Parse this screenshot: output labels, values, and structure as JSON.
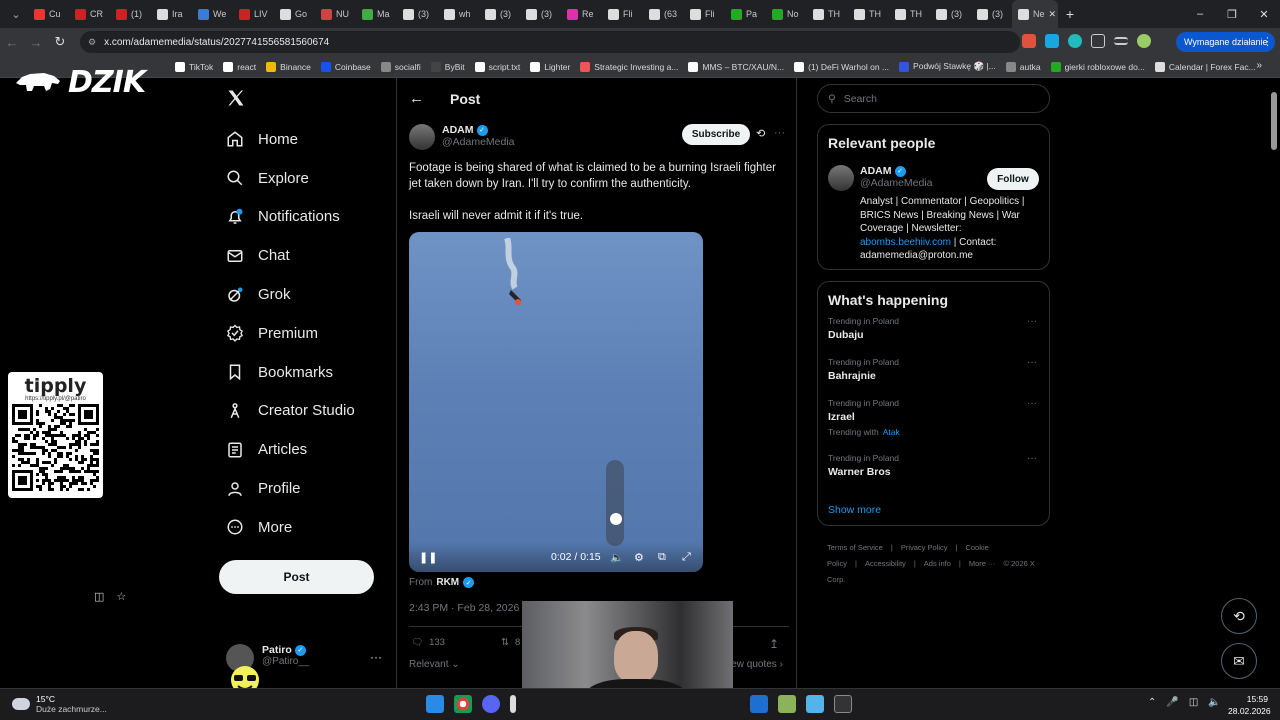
{
  "browser": {
    "tabs": [
      {
        "label": "Cu",
        "color": "#e33"
      },
      {
        "label": "CR",
        "color": "#c22"
      },
      {
        "label": "(1)",
        "color": "#c22"
      },
      {
        "label": "Ira",
        "color": "#ddd"
      },
      {
        "label": "We",
        "color": "#3a7bd5"
      },
      {
        "label": "LIV",
        "color": "#c22"
      },
      {
        "label": "Go",
        "color": "#ddd"
      },
      {
        "label": "NU",
        "color": "#c44"
      },
      {
        "label": "Ma",
        "color": "#4a4"
      },
      {
        "label": "(3)",
        "color": "#ddd"
      },
      {
        "label": "wh",
        "color": "#ddd"
      },
      {
        "label": "(3)",
        "color": "#ddd"
      },
      {
        "label": "(3)",
        "color": "#ddd"
      },
      {
        "label": "Re",
        "color": "#d3a"
      },
      {
        "label": "Fli",
        "color": "#ddd"
      },
      {
        "label": "(63",
        "color": "#ddd"
      },
      {
        "label": "Fli",
        "color": "#ddd"
      },
      {
        "label": "Pa",
        "color": "#2a2"
      },
      {
        "label": "No",
        "color": "#2a2"
      },
      {
        "label": "TH",
        "color": "#ddd"
      },
      {
        "label": "TH",
        "color": "#ddd"
      },
      {
        "label": "TH",
        "color": "#ddd"
      },
      {
        "label": "(3)",
        "color": "#ddd"
      },
      {
        "label": "(3)",
        "color": "#ddd"
      },
      {
        "label": "Ne",
        "color": "#ddd"
      }
    ],
    "url": "x.com/adamemedia/status/2027741556581560674",
    "action_required": "Wymagane działanie",
    "bookmarks": [
      {
        "label": "TikTok",
        "color": "#fff"
      },
      {
        "label": "react",
        "color": "#fff"
      },
      {
        "label": "Binance",
        "color": "#f0b90b"
      },
      {
        "label": "Coinbase",
        "color": "#1652f0"
      },
      {
        "label": "socialfi",
        "color": "#888"
      },
      {
        "label": "ByBit",
        "color": "#444"
      },
      {
        "label": "script.txt",
        "color": "#fff"
      },
      {
        "label": "Lighter",
        "color": "#fff"
      },
      {
        "label": "Strategic Investing a...",
        "color": "#e55"
      },
      {
        "label": "MMS – BTC/XAU/N...",
        "color": "#fff"
      },
      {
        "label": "(1) DeFi Warhol on ...",
        "color": "#fff"
      },
      {
        "label": "Podwój Stawkę 🎲 |...",
        "color": "#3355dd"
      },
      {
        "label": "autka",
        "color": "#888"
      },
      {
        "label": "gierki robloxowe do...",
        "color": "#2a2"
      },
      {
        "label": "Calendar | Forex Fac...",
        "color": "#ddd"
      }
    ]
  },
  "overlay": {
    "brand": "DZIK",
    "tipply_title": "tipply",
    "tipply_url": "https://tipply.pl/@patiro"
  },
  "nav": {
    "items": [
      {
        "label": "Home",
        "icon": "home-icon"
      },
      {
        "label": "Explore",
        "icon": "search-icon"
      },
      {
        "label": "Notifications",
        "icon": "bell-icon"
      },
      {
        "label": "Chat",
        "icon": "mail-icon"
      },
      {
        "label": "Grok",
        "icon": "grok-icon"
      },
      {
        "label": "Premium",
        "icon": "premium-icon"
      },
      {
        "label": "Bookmarks",
        "icon": "bookmark-icon"
      },
      {
        "label": "Creator Studio",
        "icon": "creator-icon"
      },
      {
        "label": "Articles",
        "icon": "article-icon"
      },
      {
        "label": "Profile",
        "icon": "profile-icon"
      },
      {
        "label": "More",
        "icon": "more-icon"
      }
    ],
    "post_button": "Post",
    "account_name": "Patiro",
    "account_handle": "@Patiro__"
  },
  "post": {
    "header": "Post",
    "author_name": "ADAM",
    "author_handle": "@AdameMedia",
    "subscribe": "Subscribe",
    "text_1": "Footage is being shared of what is claimed to be a burning Israeli fighter jet taken down by Iran. I'll try to confirm the authenticity.",
    "text_2": "Israeli will never admit it if it's true.",
    "video_time": "0:02 / 0:15",
    "from_label": "From",
    "from_name": "RKM",
    "timestamp": "2:43 PM · Feb 28, 2026 ·",
    "replies": "133",
    "reposts": "8",
    "sort_label": "Relevant",
    "view_quotes": "iew quotes"
  },
  "sidebar": {
    "search_placeholder": "Search",
    "relevant_title": "Relevant people",
    "person_name": "ADAM",
    "person_handle": "@AdameMedia",
    "follow": "Follow",
    "bio_text": "Analyst | Commentator | Geopolitics | BRICS News | Breaking News | War Coverage | Newsletter:",
    "bio_link": "abombs.beehiiv.com",
    "bio_contact": " | Contact: adamemedia@proton.me",
    "happening_title": "What's happening",
    "trends": [
      {
        "context": "Trending in Poland",
        "name": "Dubaju",
        "with": ""
      },
      {
        "context": "Trending in Poland",
        "name": "Bahrajnie",
        "with": ""
      },
      {
        "context": "Trending in Poland",
        "name": "Izrael",
        "with": "Atak"
      },
      {
        "context": "Trending in Poland",
        "name": "Warner Bros",
        "with": ""
      }
    ],
    "trending_with_label": "Trending with",
    "show_more": "Show more",
    "footer": [
      "Terms of Service",
      "|",
      "Privacy Policy",
      "|",
      "Cookie Policy",
      "|",
      "Accessibility",
      "|",
      "Ads info",
      "|",
      "More ···",
      "© 2026 X Corp."
    ]
  },
  "taskbar": {
    "temp": "15°C",
    "weather": "Duże zachmurze...",
    "time": "15:59",
    "date": "28.02.2026"
  }
}
